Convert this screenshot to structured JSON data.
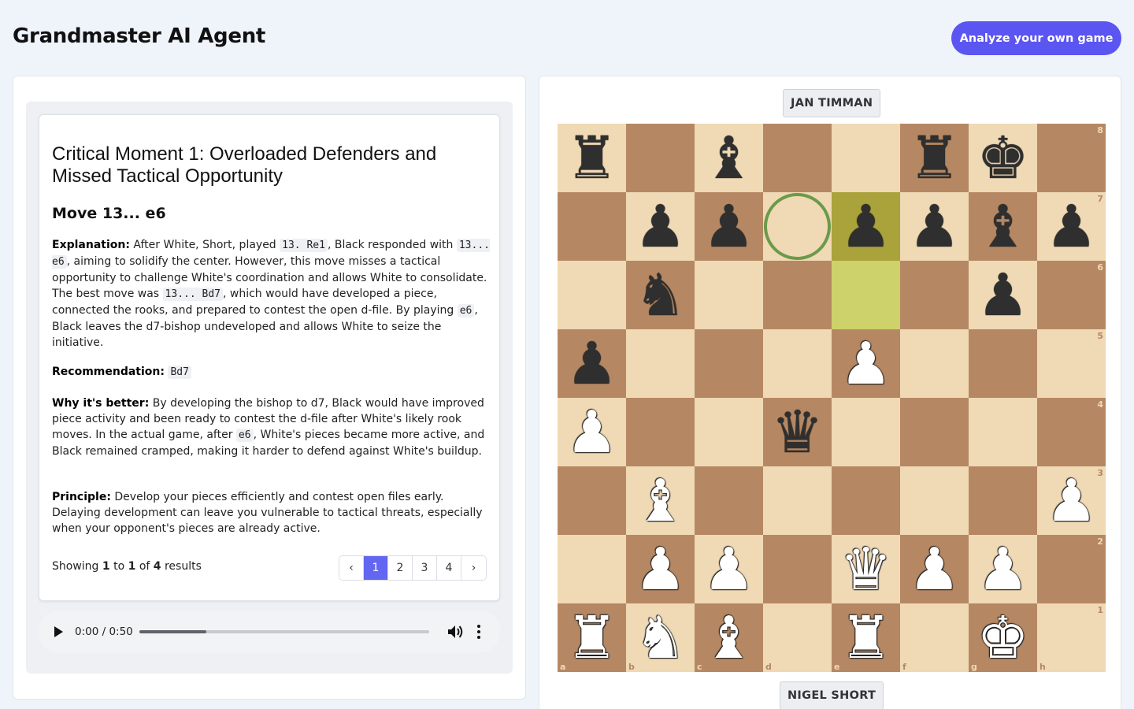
{
  "header": {
    "title": "Grandmaster AI Agent",
    "analyze_label": "Analyze your own game"
  },
  "colors": {
    "accent": "#5b55f2",
    "light_square": "#f0d9b5",
    "dark_square": "#b58863",
    "move_from": "#aaa23a",
    "move_to": "#cdd26a",
    "suggest_ring": "#6a9a4a"
  },
  "moment": {
    "title": "Critical Moment 1: Overloaded Defenders and Missed Tactical Opportunity",
    "move": "Move 13... e6",
    "explanation": {
      "label": "Explanation:",
      "t1": " After White, Short, played ",
      "c1": "13. Re1",
      "t2": ", Black responded with ",
      "c2": "13... e6",
      "t3": ", aiming to solidify the center. However, this move misses a tactical opportunity to challenge White's coordination and allows White to consolidate. The best move was ",
      "c3": "13... Bd7",
      "t4": ", which would have developed a piece, connected the rooks, and prepared to contest the open d-file. By playing ",
      "c4": "e6",
      "t5": ", Black leaves the d7-bishop undeveloped and allows White to seize the initiative."
    },
    "recommendation": {
      "label": "Recommendation:",
      "move": "Bd7"
    },
    "why": {
      "label": "Why it's better:",
      "t1": " By developing the bishop to d7, Black would have improved piece activity and been ready to contest the d-file after White's likely rook moves. In the actual game, after ",
      "c1": "e6",
      "t2": ", White's pieces became more active, and Black remained cramped, making it harder to defend against White's buildup."
    },
    "principle": {
      "label": "Principle:",
      "text": " Develop your pieces efficiently and contest open files early. Delaying development can leave you vulnerable to tactical threats, especially when your opponent's pieces are already active."
    }
  },
  "pagination": {
    "showing": "Showing",
    "from": "1",
    "to_word": "to",
    "to": "1",
    "of_word": "of",
    "total": "4",
    "results_word": "results",
    "prev": "‹",
    "next": "›",
    "pages": [
      "1",
      "2",
      "3",
      "4"
    ],
    "active": 0
  },
  "audio": {
    "time": "0:00 / 0:50",
    "progress": 0.23
  },
  "players": {
    "top": "JAN TIMMAN",
    "bottom": "NIGEL SHORT"
  },
  "board": {
    "files": [
      "a",
      "b",
      "c",
      "d",
      "e",
      "f",
      "g",
      "h"
    ],
    "ranks": [
      "8",
      "7",
      "6",
      "5",
      "4",
      "3",
      "2",
      "1"
    ],
    "rows": [
      [
        "bR",
        "",
        "bB",
        "",
        "",
        "bR",
        "bK",
        ""
      ],
      [
        "",
        "bP",
        "bP",
        "",
        "bP",
        "bP",
        "bB",
        "bP"
      ],
      [
        "",
        "bN",
        "",
        "",
        "",
        "",
        "bP",
        ""
      ],
      [
        "bP",
        "",
        "",
        "",
        "wP",
        "",
        "",
        ""
      ],
      [
        "wP",
        "",
        "",
        "bQ",
        "",
        "",
        "",
        ""
      ],
      [
        "",
        "wB",
        "",
        "",
        "",
        "",
        "",
        "wP"
      ],
      [
        "",
        "wP",
        "wP",
        "",
        "wQ",
        "wP",
        "wP",
        ""
      ],
      [
        "wR",
        "wN",
        "wB",
        "",
        "wR",
        "",
        "wK",
        ""
      ]
    ],
    "last_move": {
      "from": "e6",
      "to": "e7"
    },
    "suggested": "d7"
  }
}
